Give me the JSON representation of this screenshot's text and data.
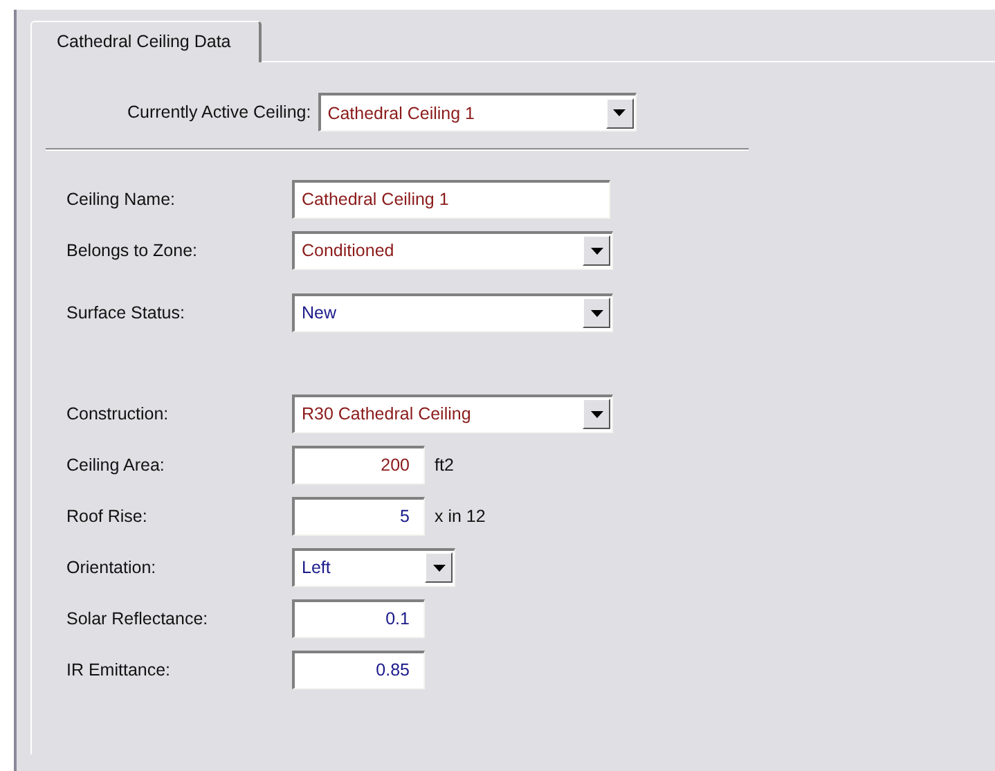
{
  "tabs": [
    {
      "label": "Cathedral Ceiling Data",
      "selected": true
    }
  ],
  "active_ceiling": {
    "label": "Currently Active Ceiling:",
    "value": "Cathedral Ceiling 1",
    "color": "#8b1a1a"
  },
  "field_groups": [
    [
      {
        "kind": "text",
        "label": "Ceiling Name:",
        "value": "Cathedral Ceiling 1",
        "color": "#8b1a1a"
      },
      {
        "kind": "dropdown",
        "label": "Belongs to Zone:",
        "value": "Conditioned",
        "color": "#8b1a1a"
      }
    ],
    [
      {
        "kind": "dropdown",
        "label": "Surface Status:",
        "value": "New",
        "color": "#1a1a8b"
      }
    ],
    [
      {
        "kind": "dropdown",
        "label": "Construction:",
        "value": "R30 Cathedral Ceiling",
        "color": "#8b1a1a"
      },
      {
        "kind": "number",
        "label": "Ceiling Area:",
        "value": "200",
        "unit": "ft2",
        "color": "#8b1a1a"
      },
      {
        "kind": "number",
        "label": "Roof Rise:",
        "value": "5",
        "unit": "x in 12",
        "color": "#1a1a8b"
      },
      {
        "kind": "short_dropdown",
        "label": "Orientation:",
        "value": "Left",
        "color": "#1a1a8b"
      },
      {
        "kind": "number",
        "label": "Solar Reflectance:",
        "value": "0.1",
        "color": "#1a1a8b"
      },
      {
        "kind": "number",
        "label": "IR Emittance:",
        "value": "0.85",
        "color": "#1a1a8b"
      }
    ]
  ]
}
